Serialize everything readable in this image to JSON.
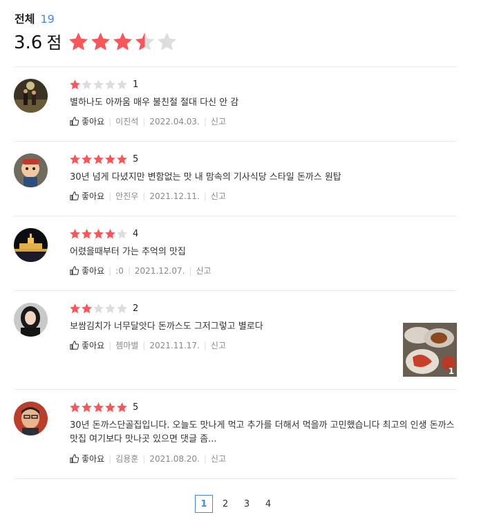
{
  "summary": {
    "label": "전체",
    "count": "19",
    "score": "3.6",
    "score_unit": "점",
    "rating": 3.5
  },
  "colors": {
    "star": "#f5575a",
    "star_off": "#dddddd",
    "accent": "#4a86d9"
  },
  "reviews": [
    {
      "rating": 1,
      "rating_text": "1",
      "text": "별하나도 아까움 매우 불친절 절대 다신 안 감",
      "like": "좋아요",
      "author": "이진석",
      "date": "2022.04.03.",
      "report": "신고"
    },
    {
      "rating": 5,
      "rating_text": "5",
      "text": "30년 넘게 다녔지만 변함없는 맛 내 맘속의 기사식당 스타일 돈까스 원탑",
      "like": "좋아요",
      "author": "안진우",
      "date": "2021.12.11.",
      "report": "신고"
    },
    {
      "rating": 4,
      "rating_text": "4",
      "text": "어렸을때부터 가는 추억의 맛집",
      "like": "좋아요",
      "author": ":0",
      "date": "2021.12.07.",
      "report": "신고"
    },
    {
      "rating": 2,
      "rating_text": "2",
      "text": "보쌈김치가 너무달앗다   돈까스도 그저그렇고   별로다",
      "like": "좋아요",
      "author": "젬마별",
      "date": "2021.11.17.",
      "report": "신고",
      "photo_count": "1"
    },
    {
      "rating": 5,
      "rating_text": "5",
      "text": "30년 돈까스단골집입니다. 오늘도 맛나게 먹고 추가를 더해서 먹을까 고민했습니다 최고의 인생 돈까스맛집 여기보다 맛나곳 있으면 댓글 좀...",
      "like": "좋아요",
      "author": "김용훈",
      "date": "2021.08.20.",
      "report": "신고"
    }
  ],
  "pagination": {
    "pages": [
      "1",
      "2",
      "3",
      "4"
    ],
    "current": "1"
  }
}
